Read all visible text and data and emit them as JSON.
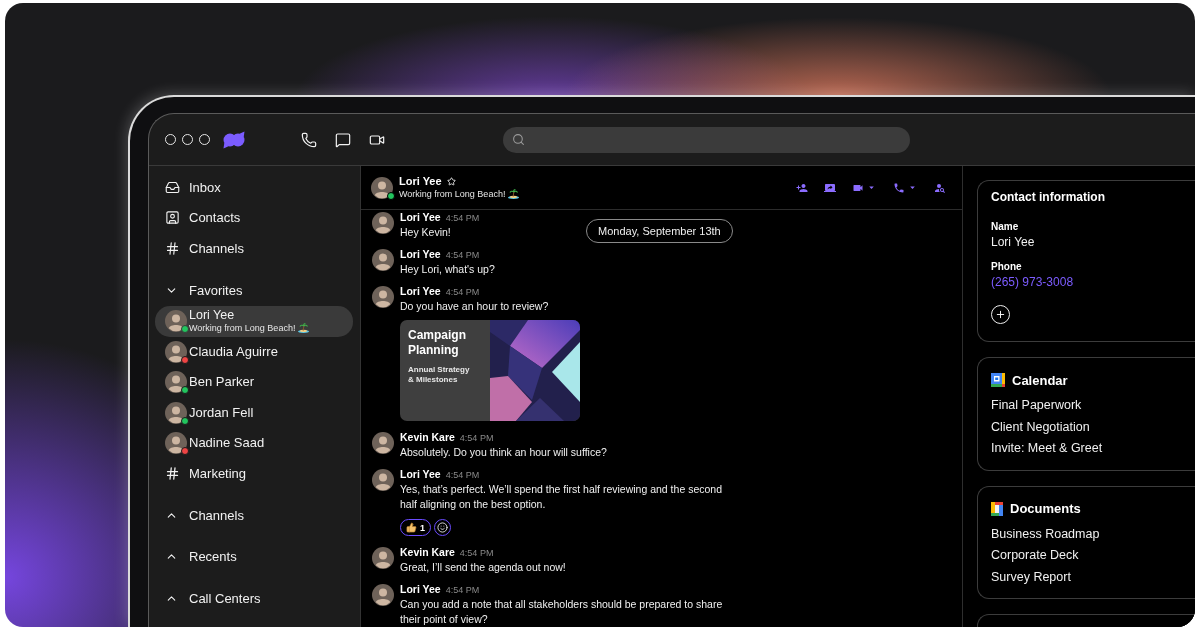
{
  "top_bar": {
    "nav": [
      {
        "kind": "phone"
      },
      {
        "kind": "chat"
      },
      {
        "kind": "video"
      }
    ]
  },
  "sidebar": {
    "nav": [
      {
        "kind": "inbox",
        "label": "Inbox"
      },
      {
        "kind": "contacts",
        "label": "Contacts"
      },
      {
        "kind": "channels",
        "label": "Channels"
      }
    ],
    "sections": [
      {
        "label": "Favorites",
        "expanded": true,
        "items": [
          {
            "kind": "contact",
            "name": "Lori Yee",
            "status": "Working from Long Beach!",
            "emoji": true,
            "color": "#22c55e",
            "selected": true
          },
          {
            "kind": "contact",
            "name": "Claudia Aguirre",
            "color": "#ef4444",
            "selected": false
          },
          {
            "kind": "contact",
            "name": "Ben Parker",
            "color": "#22c55e",
            "selected": false
          },
          {
            "kind": "contact",
            "name": "Jordan Fell",
            "color": "#22c55e",
            "selected": false
          },
          {
            "kind": "contact",
            "name": "Nadine Saad",
            "color": "#ef4444",
            "selected": false
          },
          {
            "kind": "channel",
            "name": "Marketing",
            "selected": false
          }
        ]
      },
      {
        "label": "Channels",
        "expanded": false
      },
      {
        "label": "Recents",
        "expanded": false
      },
      {
        "label": "Call Centers",
        "expanded": false
      }
    ]
  },
  "chat": {
    "header": {
      "name": "Lori Yee",
      "starred": false,
      "status": "Working from Long Beach!",
      "emoji": true,
      "color": "#22c55e",
      "actions": [
        {
          "kind": "add-person",
          "menu": false
        },
        {
          "kind": "screen-share",
          "menu": false
        },
        {
          "kind": "video",
          "menu": true
        },
        {
          "kind": "phone",
          "menu": true
        },
        {
          "kind": "find-person",
          "menu": false
        }
      ]
    },
    "date_label": "Monday, September 13th",
    "messages": [
      {
        "author": "Lori Yee",
        "time": "4:54 PM",
        "text": "Hey Kevin!"
      },
      {
        "author": "Lori Yee",
        "time": "4:54 PM",
        "text": "Hey Lori, what's up?"
      },
      {
        "author": "Lori Yee",
        "time": "4:54 PM",
        "text": "Do you have an hour to review?",
        "attachment": {
          "title": "Campaign Planning",
          "lines": [
            "Annual Strategy",
            "& Milestones"
          ]
        }
      },
      {
        "author": "Kevin Kare",
        "time": "4:54 PM",
        "text": "Absolutely. Do you think an hour will suffice?"
      },
      {
        "author": "Lori Yee",
        "time": "4:54 PM",
        "text": "Yes, that’s perfect. We’ll spend the first half reviewing and the second half aligning on the best option.",
        "reactions": [
          {
            "kind": "thumbs-up",
            "count": "1"
          }
        ]
      },
      {
        "author": "Kevin Kare",
        "time": "4:54 PM",
        "text": "Great, I’ll send the agenda out now!"
      },
      {
        "author": "Lori Yee",
        "time": "4:54 PM",
        "text": "Can you add a note that all stakeholders should be prepared to share their point of view?"
      }
    ]
  },
  "details": {
    "contact": {
      "title": "Contact information",
      "fields": [
        {
          "label": "Name",
          "value": "Lori Yee",
          "kind": "text"
        },
        {
          "label": "Phone",
          "value": "(265) 973-3008",
          "kind": "phone"
        }
      ]
    },
    "cards": [
      {
        "kind": "calendar",
        "title": "Calendar",
        "items": [
          "Final Paperwork",
          "Client Negotiation",
          "Invite: Meet & Greet"
        ]
      },
      {
        "kind": "documents",
        "title": "Documents",
        "items": [
          "Business Roadmap",
          "Corporate Deck",
          "Survey Report"
        ]
      }
    ]
  }
}
